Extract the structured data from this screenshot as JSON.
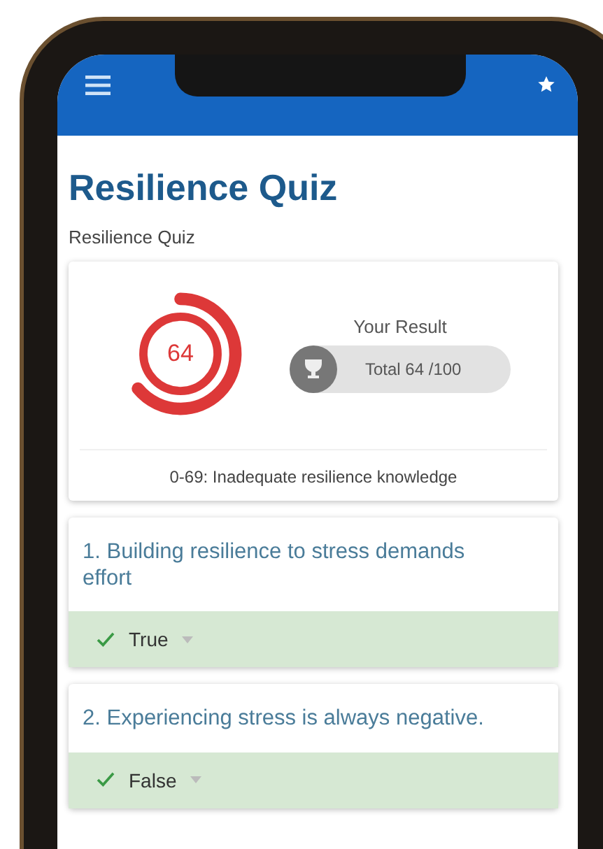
{
  "title": "Resilience Quiz",
  "subtitle": "Resilience Quiz",
  "result": {
    "score": "64",
    "level": 0.64,
    "label": "Your Result",
    "total": "Total 64 /100",
    "verdict": "0-69: Inadequate resilience knowledge"
  },
  "questions": [
    {
      "text": "1. Building resilience to stress demands effort",
      "answer": "True",
      "correct": true
    },
    {
      "text": "2. Experiencing stress is always negative.",
      "answer": "False",
      "correct": true
    }
  ]
}
